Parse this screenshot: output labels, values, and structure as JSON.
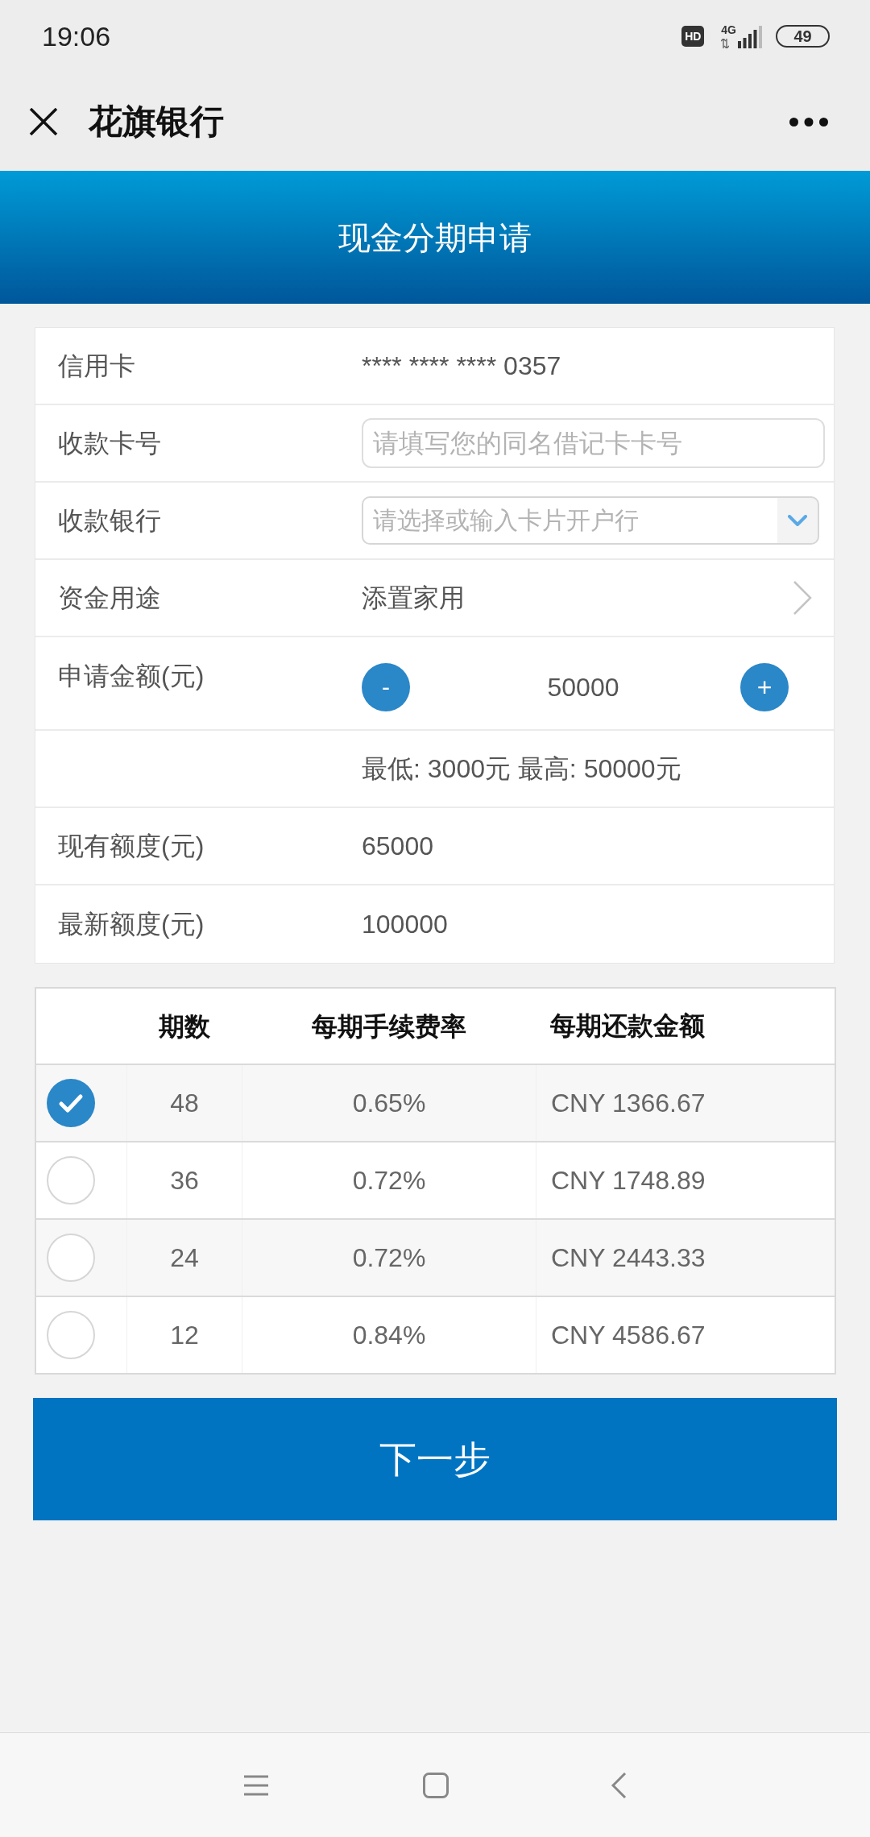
{
  "status_bar": {
    "time": "19:06",
    "hd_badge": "HD",
    "network": "4G",
    "battery": "49"
  },
  "title_bar": {
    "title": "花旗银行"
  },
  "banner": {
    "title": "现金分期申请"
  },
  "form": {
    "rows": [
      {
        "kind": "text",
        "label": "信用卡",
        "value": "**** **** **** 0357"
      },
      {
        "kind": "input",
        "label": "收款卡号",
        "placeholder": "请填写您的同名借记卡卡号"
      },
      {
        "kind": "select",
        "label": "收款银行",
        "placeholder": "请选择或输入卡片开户行"
      },
      {
        "kind": "link",
        "label": "资金用途",
        "value": "添置家用"
      },
      {
        "kind": "stepper",
        "label": "申请金额(元)",
        "decrease": "-",
        "value": "50000",
        "increase": "+"
      },
      {
        "kind": "text",
        "value": "最低: 3000元 最高: 50000元"
      },
      {
        "kind": "text",
        "label": "现有额度(元)",
        "value": "65000"
      },
      {
        "kind": "text",
        "label": "最新额度(元)",
        "value": "100000"
      }
    ]
  },
  "plans": {
    "columns": [
      "期数",
      "每期手续费率",
      "每期还款金额"
    ],
    "rows": [
      {
        "selected": true,
        "term": "48",
        "rate": "0.65%",
        "payment": "CNY 1366.67"
      },
      {
        "selected": false,
        "term": "36",
        "rate": "0.72%",
        "payment": "CNY 1748.89"
      },
      {
        "selected": false,
        "term": "24",
        "rate": "0.72%",
        "payment": "CNY 2443.33"
      },
      {
        "selected": false,
        "term": "12",
        "rate": "0.84%",
        "payment": "CNY 4586.67"
      }
    ]
  },
  "next_button": {
    "label": "下一步"
  }
}
